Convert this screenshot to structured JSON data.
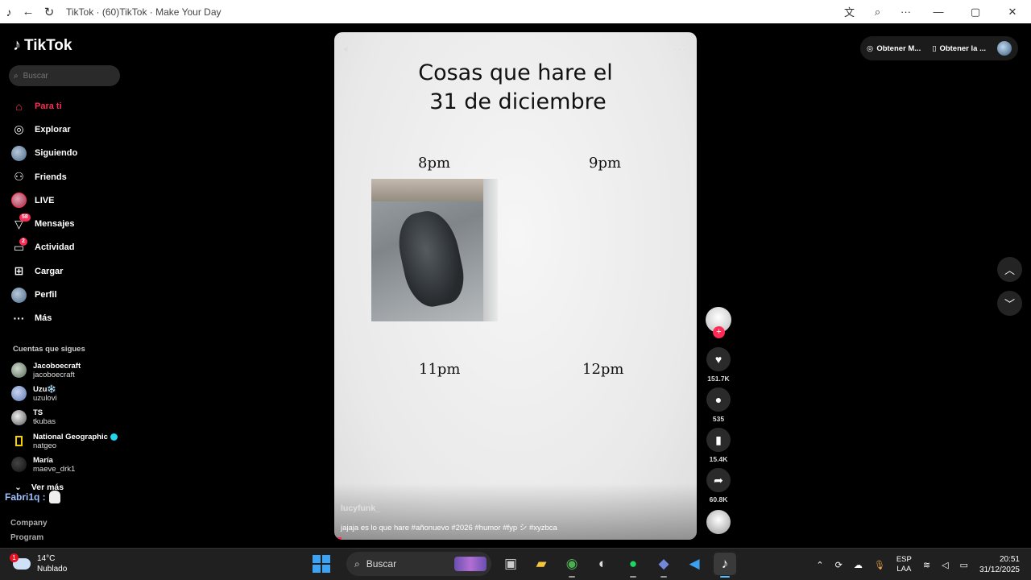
{
  "titlebar": {
    "title": "TikTok · (60)TikTok · Make Your Day",
    "icons": [
      "tiktok-icon",
      "back-arrow-icon",
      "refresh-icon",
      "translate-icon",
      "zoom-icon",
      "more-icon",
      "minimize-icon",
      "maximize-icon",
      "close-icon"
    ]
  },
  "logo": {
    "text": "TikTok"
  },
  "search": {
    "placeholder": "Buscar"
  },
  "nav": [
    {
      "label": "Para ti",
      "icon": "home-icon"
    },
    {
      "label": "Explorar",
      "icon": "compass-icon"
    },
    {
      "label": "Siguiendo",
      "icon": "avatar"
    },
    {
      "label": "Friends",
      "icon": "friends-icon"
    },
    {
      "label": "LIVE",
      "icon": "live-avatar"
    },
    {
      "label": "Mensajes",
      "icon": "send-icon",
      "badge": "58"
    },
    {
      "label": "Actividad",
      "icon": "inbox-icon",
      "badge": "2"
    },
    {
      "label": "Cargar",
      "icon": "plus-box-icon"
    },
    {
      "label": "Perfil",
      "icon": "avatar"
    },
    {
      "label": "Más",
      "icon": "dots-icon"
    }
  ],
  "following": {
    "title": "Cuentas que sigues",
    "accounts": [
      {
        "name": "Jacoboecraft",
        "user": "jacoboecraft"
      },
      {
        "name": "Uzu❄️",
        "user": "uzulovi"
      },
      {
        "name": "TS",
        "user": "tkubas"
      },
      {
        "name": "National Geographic",
        "user": "natgeo",
        "verified": true
      },
      {
        "name": "María",
        "user": "maeve_drk1"
      }
    ],
    "more": "Ver más"
  },
  "overlay_user": "Fabri1q :",
  "footer": [
    "Company",
    "Program"
  ],
  "video": {
    "headline_line1": "Cosas que hare el",
    "headline_line2": "31 de diciembre",
    "hours": [
      "8pm",
      "9pm",
      "11pm",
      "12pm"
    ],
    "author": "lucyfunk_",
    "caption": "jajaja es lo que hare #añonuevo #2026 #humor #fyp シ #xyzbca",
    "progress": 0.02
  },
  "actions": {
    "likes": "151.7K",
    "comments": "535",
    "saves": "15.4K",
    "shares": "60.8K"
  },
  "topright": {
    "item1": "Obtener M...",
    "item2": "Obtener la ..."
  },
  "taskbar": {
    "temp": "14°C",
    "condition": "Nublado",
    "weather_badge": "1",
    "search": "Buscar",
    "lang1": "ESP",
    "lang2": "LAA",
    "time": "20:51",
    "date": "31/12/2025"
  }
}
